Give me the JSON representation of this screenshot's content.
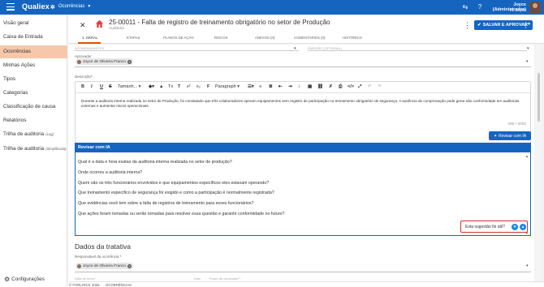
{
  "topbar": {
    "logo": "Qualiex",
    "module": "Ocorrências",
    "user_name": "Joyce (Administrador)",
    "user_org": "FL Joyce"
  },
  "sidebar": {
    "items": [
      {
        "label": "Visão geral",
        "note": ""
      },
      {
        "label": "Caixa de Entrada",
        "note": ""
      },
      {
        "label": "Ocorrências",
        "note": "",
        "active": true
      },
      {
        "label": "Minhas Ações",
        "note": ""
      },
      {
        "label": "Tipos",
        "note": ""
      },
      {
        "label": "Categorias",
        "note": ""
      },
      {
        "label": "Classificação de causa",
        "note": ""
      },
      {
        "label": "Relatórios",
        "note": ""
      },
      {
        "label": "Trilha de auditoria",
        "note": "(Log)"
      },
      {
        "label": "Trilha de auditoria",
        "note": "(Simplificada)"
      }
    ],
    "config_label": "Configurações"
  },
  "header": {
    "title": "25-00011 - Falta de registro de treinamento obrigatório no setor de Produção",
    "subtitle": "Auditoria",
    "save_label": "SALVAR E APROVAR"
  },
  "tabs": [
    "1. GERAL",
    "ETAPAS",
    "PLANOS DE AÇÃO",
    "RISCOS",
    "ANEXOS (0)",
    "COMENTÁRIOS (0)",
    "HISTÓRICO"
  ],
  "form": {
    "faded_left": "ACOMPANHANTES",
    "faded_right": "EMISSÃO (OPTIONAL)",
    "approver_label": "Aprovador",
    "approver_name": "Joyce de Oliveira Franco",
    "description_label": "Descrição*",
    "toolbar": {
      "font_label": "Tamanh...",
      "paragraph_label": "Paragraph"
    },
    "description_text": "Durante a auditoria interna realizada no setor de Produção, foi constatado que três colaboradores operam equipamentos sem registro de participação no treinamento obrigatório de segurança. A ausência de comprovação pode gerar não conformidade em auditorias externas e aumentar riscos operacionais.",
    "counter": "296 / 4000",
    "revisar_button": "Revisar com IA"
  },
  "ai_panel": {
    "title": "Revisar com IA",
    "questions": [
      "Qual é a data e hora exatas da auditoria interna realizada no setor de produção?",
      "Onde ocorreu a auditoria interna?",
      "Quem são os três funcionários envolvidos e que equipamentos específicos eles estavam operando?",
      "Que treinamento específico de segurança foi exigido e como a participação é normalmente registrada?",
      "Que evidências você tem sobre a falta de registros de treinamento para esses funcionários?",
      "Que ações foram tomadas ou serão tomadas para resolver essa questão e garantir conformidade no futuro?"
    ],
    "feedback_label": "Esta sugestão foi útil?"
  },
  "treatment": {
    "title": "Dados da tratativa",
    "responsible_label": "Responsável da ocorrência *",
    "responsible_name": "Joyce de Oliveira Franco",
    "footer_left": "Data de início*",
    "footer_mid": "Dias",
    "footer_right": "Prazo de conclusão**"
  },
  "bottom_bar": {
    "copyright": "© FORLOGIC 2025",
    "section": "OCORRÊNCIAS"
  }
}
